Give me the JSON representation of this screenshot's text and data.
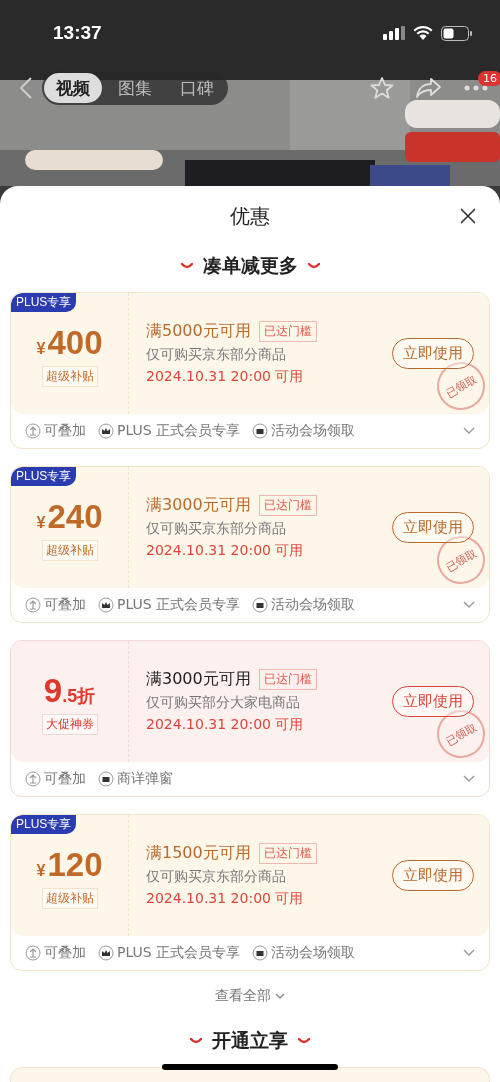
{
  "status_bar": {
    "time": "13:37"
  },
  "nav": {
    "tabs": [
      {
        "label": "视频",
        "selected": true
      },
      {
        "label": "图集",
        "selected": false
      },
      {
        "label": "口碑",
        "selected": false
      }
    ],
    "badge": "16"
  },
  "sheet": {
    "title": "优惠",
    "sections": [
      {
        "title": "凑单减更多",
        "coupons": [
          {
            "kind": "amount",
            "badge": "PLUS专享",
            "currency": "¥",
            "value": "400",
            "tag": "超级补贴",
            "title": "满5000元可用",
            "status": "已达门槛",
            "scope": "仅可购买京东部分商品",
            "date": "2024.10.31 20:00 可用",
            "button": "立即使用",
            "stamp": "已领取",
            "features": [
              {
                "kind": "stack",
                "label": "可叠加"
              },
              {
                "kind": "crown",
                "label": "PLUS 正式会员专享"
              },
              {
                "kind": "ticket",
                "label": "活动会场领取"
              }
            ]
          },
          {
            "kind": "amount",
            "badge": "PLUS专享",
            "currency": "¥",
            "value": "240",
            "tag": "超级补贴",
            "title": "满3000元可用",
            "status": "已达门槛",
            "scope": "仅可购买京东部分商品",
            "date": "2024.10.31 20:00 可用",
            "button": "立即使用",
            "stamp": "已领取",
            "features": [
              {
                "kind": "stack",
                "label": "可叠加"
              },
              {
                "kind": "crown",
                "label": "PLUS 正式会员专享"
              },
              {
                "kind": "ticket",
                "label": "活动会场领取"
              }
            ]
          },
          {
            "kind": "discount",
            "value": "9",
            "unit": ".5折",
            "tag": "大促神券",
            "title": "满3000元可用",
            "status": "已达门槛",
            "scope": "仅可购买部分大家电商品",
            "date": "2024.10.31 20:00 可用",
            "button": "立即使用",
            "stamp": "已领取",
            "features": [
              {
                "kind": "stack",
                "label": "可叠加"
              },
              {
                "kind": "ticket",
                "label": "商详弹窗"
              }
            ]
          },
          {
            "kind": "amount",
            "badge": "PLUS专享",
            "currency": "¥",
            "value": "120",
            "tag": "超级补贴",
            "title": "满1500元可用",
            "status": "已达门槛",
            "scope": "仅可购买京东部分商品",
            "date": "2024.10.31 20:00 可用",
            "button": "立即使用",
            "features": [
              {
                "kind": "stack",
                "label": "可叠加"
              },
              {
                "kind": "crown",
                "label": "PLUS 正式会员专享"
              },
              {
                "kind": "ticket",
                "label": "活动会场领取"
              }
            ]
          }
        ],
        "more": "查看全部"
      },
      {
        "title": "开通立享"
      }
    ]
  }
}
